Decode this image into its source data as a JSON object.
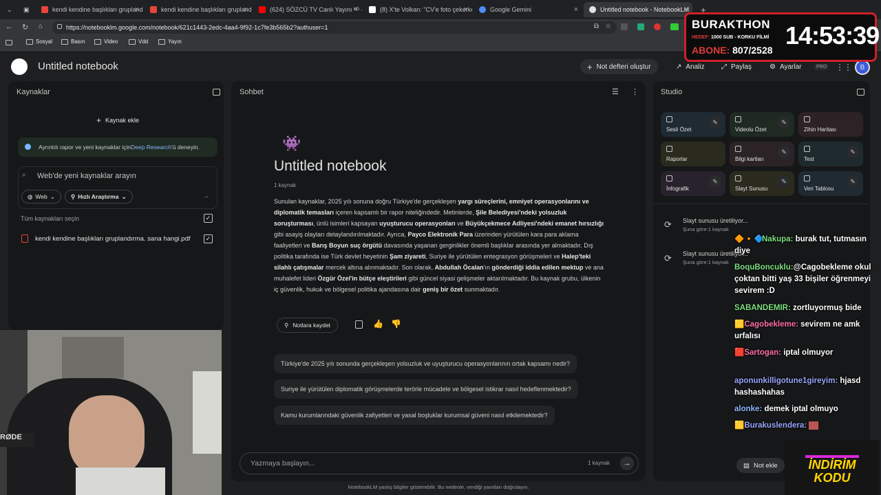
{
  "browser": {
    "tabs": [
      {
        "title": "kendi kendine başlıkları gruplandır",
        "color": "#e8453c"
      },
      {
        "title": "kendi kendine başlıkları gruplandır",
        "color": "#e8453c"
      },
      {
        "title": "(624) SÖZCÜ TV Canlı Yayını ᴴᴰ - Yo",
        "color": "#ff0000"
      },
      {
        "title": "(8) X'te Volkan: \"CV'e foto çekerke",
        "color": "#ffffff"
      },
      {
        "title": "Google Gemini",
        "color": "#4f8df5"
      },
      {
        "title": "Untitled notebook - NotebookLM",
        "color": "#e3e3e3"
      }
    ],
    "url": "https://notebooklm.google.com/notebook/621c1443-2edc-4aa4-9f92-1c7fe3b565b2?authuser=1",
    "bookmarks": [
      "Sosyal",
      "Basın",
      "Video",
      "Vdd",
      "Yayın"
    ]
  },
  "app": {
    "title": "Untitled notebook",
    "create_notebook": "Not defteri oluştur",
    "analyze": "Analiz",
    "share": "Paylaş",
    "settings": "Ayarlar",
    "pro_badge": "PRO",
    "avatar": "B"
  },
  "sources": {
    "title": "Kaynaklar",
    "add_source": "Kaynak ekle",
    "deep_research_pre": "Ayrıntılı rapor ve yeni kaynaklar için ",
    "deep_research_link": "Deep Research",
    "deep_research_post": "'ü deneyin.",
    "search_placeholder": "Web'de yeni kaynaklar arayın",
    "web_chip": "Web",
    "fast_research_chip": "Hızlı Araştırma",
    "select_all": "Tüm kaynakları seçin",
    "items": [
      {
        "name": "kendi kendine başlıkları gruplandırma. sana hangi.pdf"
      }
    ]
  },
  "chat": {
    "title": "Sohbet",
    "emoji": "👾",
    "notebook_title": "Untitled notebook",
    "source_count": "1 kaynak",
    "save_note": "Notlara kaydet",
    "suggestions": [
      "Türkiye'de 2025 yılı sonunda gerçekleşen yolsuzluk ve uyuşturucu operasyonlarının ortak kapsamı nedir?",
      "Suriye ile yürütülen diplomatik görüşmelerde terörle mücadele ve bölgesel istikrar nasıl hedeflenmektedir?",
      "Kamu kurumlarındaki güvenlik zafiyetleri ve yasal boşluklar kurumsal güveni nasıl etkilemektedir?"
    ],
    "input_placeholder": "Yazmaya başlayın...",
    "input_source_count": "1 kaynak",
    "footer": "NotebookLM yanlış bilgiler gösterebilir. Bu nedenle, verdiği yanıtları doğrulayın."
  },
  "studio": {
    "title": "Studio",
    "tiles": [
      {
        "label": "Sesli Özet",
        "color": "#1f2a33"
      },
      {
        "label": "Videolu Özet",
        "color": "#1e2a22"
      },
      {
        "label": "Zihin Haritası",
        "color": "#2d2226"
      },
      {
        "label": "Raporlar",
        "color": "#2a2a1e"
      },
      {
        "label": "Bilgi kartları",
        "color": "#2b2326"
      },
      {
        "label": "Test",
        "color": "#1f2a2e"
      },
      {
        "label": "İnfografik",
        "color": "#28222c"
      },
      {
        "label": "Slayt Sunusu",
        "color": "#2a2a1e"
      },
      {
        "label": "Veri Tablosu",
        "color": "#1f2a33"
      }
    ],
    "generating": [
      {
        "title": "Slayt sunusu üretiliyor...",
        "sub": "Şuna göre:1 kaynak"
      },
      {
        "title": "Slayt sunusu üretiliyor...",
        "sub": "Şuna göre:1 kaynak"
      }
    ],
    "add_note": "Not ekle"
  },
  "overlay": {
    "streamer": "BURAKTHON",
    "goal_label": "HEDEF:",
    "goal_text": "1000 SUB - KORKU FİLMİ",
    "sub_label": "ABONE:",
    "sub_count": "807/2528",
    "timer": "14:53:39",
    "promo_top": "İNDİRİM",
    "promo_bottom": "KODU",
    "chat": [
      {
        "user": "Nakupa:",
        "msg": "burak tut, tutmasın diye",
        "color": "#7ee081"
      },
      {
        "user": "BoquBoncuklu:",
        "msg": "@Cagobekleme okul çoktan bitti yaş 33 bişiler öğrenmeyi sevirem :D",
        "color": "#7ee081"
      },
      {
        "user": "SABANDEMIR:",
        "msg": "zortluyormuş bide",
        "color": "#7ee081"
      },
      {
        "user": "Cagobekleme:",
        "msg": "sevirem ne amk urfalısı",
        "color": "#ff6fa8"
      },
      {
        "user": "Sartogan:",
        "msg": "iptal olmuyor",
        "color": "#ff6fa8"
      },
      {
        "user": "aponunkilligotune1gireyim:",
        "msg": "hjasd hashashahas",
        "color": "#9aa6ff"
      },
      {
        "user": "alonke:",
        "msg": "demek iptal olmuyo",
        "color": "#8fb8ff"
      },
      {
        "user": "Burakuslendera:",
        "msg": "",
        "color": "#9aa6ff"
      }
    ]
  }
}
